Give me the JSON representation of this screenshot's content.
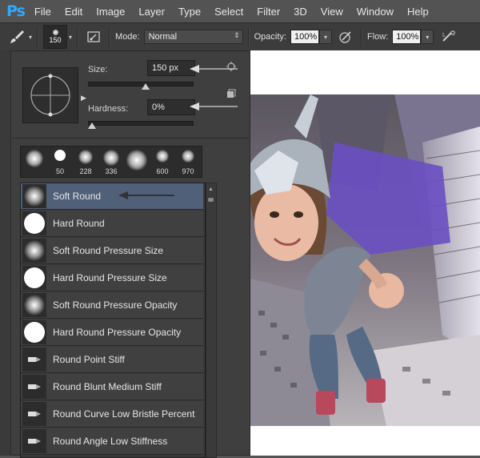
{
  "app": {
    "logo": "Ps"
  },
  "menu": [
    "File",
    "Edit",
    "Image",
    "Layer",
    "Type",
    "Select",
    "Filter",
    "3D",
    "View",
    "Window",
    "Help"
  ],
  "options_bar": {
    "tool_icon": "brush-icon",
    "brush_size": "150",
    "mode_label": "Mode:",
    "mode_value": "Normal",
    "opacity_label": "Opacity:",
    "opacity_value": "100%",
    "flow_label": "Flow:",
    "flow_value": "100%"
  },
  "brush_panel": {
    "size_label": "Size:",
    "size_value": "150 px",
    "size_fraction": 0.55,
    "hardness_label": "Hardness:",
    "hardness_value": "0%",
    "hardness_fraction": 0.0,
    "presets": [
      {
        "label": "",
        "kind": "soft"
      },
      {
        "label": "50",
        "kind": "hard"
      },
      {
        "label": "228",
        "kind": "soft"
      },
      {
        "label": "336",
        "kind": "soft"
      },
      {
        "label": "",
        "kind": "soft"
      },
      {
        "label": "600",
        "kind": "soft"
      },
      {
        "label": "970",
        "kind": "soft"
      }
    ],
    "brushes": [
      {
        "label": "Soft Round",
        "icon": "soft-round",
        "selected": true
      },
      {
        "label": "Hard Round",
        "icon": "hard-round",
        "selected": false
      },
      {
        "label": "Soft Round Pressure Size",
        "icon": "soft-round",
        "selected": false
      },
      {
        "label": "Hard Round Pressure Size",
        "icon": "hard-round",
        "selected": false
      },
      {
        "label": "Soft Round Pressure Opacity",
        "icon": "soft-round",
        "selected": false
      },
      {
        "label": "Hard Round Pressure Opacity",
        "icon": "hard-round",
        "selected": false
      },
      {
        "label": "Round Point Stiff",
        "icon": "bristle",
        "selected": false
      },
      {
        "label": "Round Blunt Medium Stiff",
        "icon": "bristle",
        "selected": false
      },
      {
        "label": "Round Curve Low Bristle Percent",
        "icon": "bristle",
        "selected": false
      },
      {
        "label": "Round Angle Low Stiffness",
        "icon": "bristle",
        "selected": false
      }
    ]
  },
  "colors": {
    "accent": "#31a8ff",
    "selected_row": "#506079"
  }
}
